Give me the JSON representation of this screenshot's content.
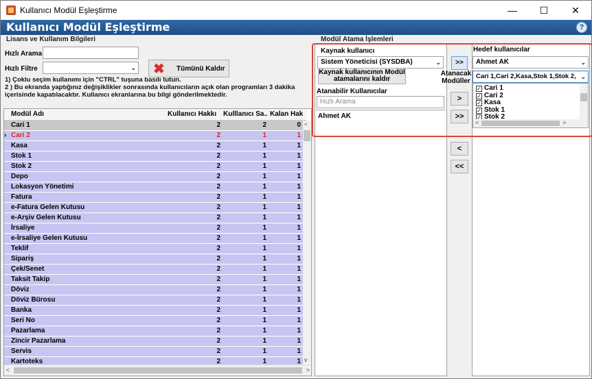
{
  "window": {
    "title": "Kullanıcı Modül Eşleştirme",
    "minimize": "—",
    "maximize": "☐",
    "close": "✕"
  },
  "header": {
    "title": "Kullanıcı Modül Eşleştirme",
    "help": "?"
  },
  "left": {
    "section_title": "Lisans ve Kullanım Bilgileri",
    "quick_search_label": "Hızlı Arama",
    "quick_search_value": "",
    "quick_filter_label": "Hızlı Filtre",
    "quick_filter_value": "",
    "remove_all_label": "Tümünü Kaldır",
    "info_line1": "1) Çoklu seçim kullanımı için \"CTRL\" tuşuna basılı tutun.",
    "info_line2": "2 ) Bu ekranda yaptığınız değişiklikler sonrasında kullanıcıların açık olan programları 3 dakika",
    "info_line3": "içerisinde kapatılacaktır. Kullanıcı ekranlarına bu bilgi gönderilmektedir."
  },
  "grid": {
    "columns": [
      "Modül Adı",
      "Kullanıcı Hakkı",
      "Kulllanıcı Sa...",
      "Kalan Hak"
    ],
    "rows": [
      [
        "Cari 1",
        "2",
        "2",
        "0"
      ],
      [
        "Cari 2",
        "2",
        "1",
        "1"
      ],
      [
        "Kasa",
        "2",
        "1",
        "1"
      ],
      [
        "Stok 1",
        "2",
        "1",
        "1"
      ],
      [
        "Stok 2",
        "2",
        "1",
        "1"
      ],
      [
        "Depo",
        "2",
        "1",
        "1"
      ],
      [
        "Lokasyon Yönetimi",
        "2",
        "1",
        "1"
      ],
      [
        "Fatura",
        "2",
        "1",
        "1"
      ],
      [
        "e-Fatura Gelen Kutusu",
        "2",
        "1",
        "1"
      ],
      [
        "e-Arşiv Gelen Kutusu",
        "2",
        "1",
        "1"
      ],
      [
        "İrsaliye",
        "2",
        "1",
        "1"
      ],
      [
        "e-İrsaliye Gelen Kutusu",
        "2",
        "1",
        "1"
      ],
      [
        "Teklif",
        "2",
        "1",
        "1"
      ],
      [
        "Sipariş",
        "2",
        "1",
        "1"
      ],
      [
        "Çek/Senet",
        "2",
        "1",
        "1"
      ],
      [
        "Taksit Takip",
        "2",
        "1",
        "1"
      ],
      [
        "Döviz",
        "2",
        "1",
        "1"
      ],
      [
        "Döviz Bürosu",
        "2",
        "1",
        "1"
      ],
      [
        "Banka",
        "2",
        "1",
        "1"
      ],
      [
        "Seri No",
        "2",
        "1",
        "1"
      ],
      [
        "Pazarlama",
        "2",
        "1",
        "1"
      ],
      [
        "Zincir Pazarlama",
        "2",
        "1",
        "1"
      ],
      [
        "Servis",
        "2",
        "1",
        "1"
      ],
      [
        "Kartoteks",
        "2",
        "1",
        "1"
      ]
    ],
    "selected_index": 1
  },
  "right": {
    "section_title": "Modül Atama İşlemleri",
    "source_label": "Kaynak kullanıcı",
    "source_value": "Sistem Yöneticisi (SYSDBA)",
    "remove_source_label_1": "Kaynak kullanıcının Modül",
    "remove_source_label_2": "atamalarını kaldır",
    "copy_btn": ">>",
    "assigned_label_1": "Atanacak",
    "assigned_label_2": "Modüller",
    "target_label": "Hedef kullanıcılar",
    "target_value": "Ahmet  AK",
    "assignable_label": "Atanabilir Kullanıcılar",
    "assignable_search_placeholder": "Hızlı Arama",
    "assignable_users": [
      "Ahmet  AK"
    ],
    "modules_combo_value": "Cari 1,Cari 2,Kasa,Stok 1,Stok 2,",
    "module_checks": [
      "Cari 1",
      "Cari 2",
      "Kasa",
      "Stok 1",
      "Stok 2"
    ],
    "btn_add_one": ">",
    "btn_add_all": ">>",
    "btn_remove_one": "<",
    "btn_remove_all": "<<"
  }
}
